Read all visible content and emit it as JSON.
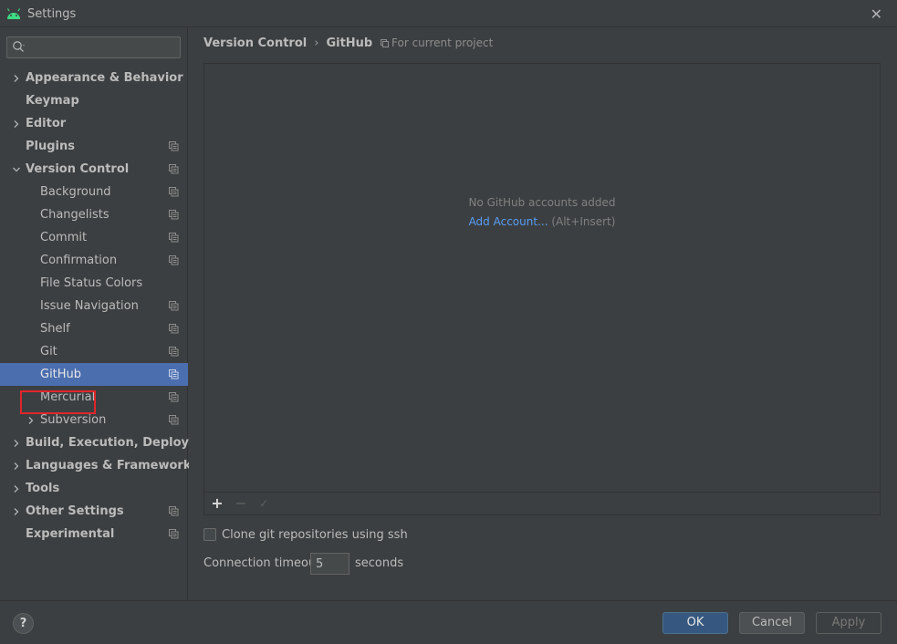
{
  "window": {
    "title": "Settings",
    "close_glyph": "✕"
  },
  "search": {
    "value": "",
    "placeholder": ""
  },
  "sidebar": {
    "items": [
      {
        "label": "Appearance & Behavior",
        "expander": "collapsed",
        "project": false
      },
      {
        "label": "Keymap",
        "expander": "none",
        "project": false
      },
      {
        "label": "Editor",
        "expander": "collapsed",
        "project": false
      },
      {
        "label": "Plugins",
        "expander": "none",
        "project": true
      },
      {
        "label": "Version Control",
        "expander": "expanded",
        "project": true
      },
      {
        "label": "Background",
        "expander": "none",
        "project": true
      },
      {
        "label": "Changelists",
        "expander": "none",
        "project": true
      },
      {
        "label": "Commit",
        "expander": "none",
        "project": true
      },
      {
        "label": "Confirmation",
        "expander": "none",
        "project": true
      },
      {
        "label": "File Status Colors",
        "expander": "none",
        "project": false
      },
      {
        "label": "Issue Navigation",
        "expander": "none",
        "project": true
      },
      {
        "label": "Shelf",
        "expander": "none",
        "project": true
      },
      {
        "label": "Git",
        "expander": "none",
        "project": true
      },
      {
        "label": "GitHub",
        "expander": "none",
        "project": true,
        "selected": true
      },
      {
        "label": "Mercurial",
        "expander": "none",
        "project": true
      },
      {
        "label": "Subversion",
        "expander": "collapsed",
        "project": true
      },
      {
        "label": "Build, Execution, Deployment",
        "expander": "collapsed",
        "project": false
      },
      {
        "label": "Languages & Frameworks",
        "expander": "collapsed",
        "project": false
      },
      {
        "label": "Tools",
        "expander": "collapsed",
        "project": false
      },
      {
        "label": "Other Settings",
        "expander": "collapsed",
        "project": true
      },
      {
        "label": "Experimental",
        "expander": "none",
        "project": true
      }
    ]
  },
  "breadcrumb": {
    "parent": "Version Control",
    "separator": "›",
    "current": "GitHub",
    "scope": "For current project"
  },
  "accounts": {
    "empty_text": "No GitHub accounts added",
    "add_link": "Add Account...",
    "add_shortcut": " (Alt+Insert)",
    "toolbar": {
      "add": "+",
      "remove": "−",
      "check": "✓"
    }
  },
  "options": {
    "clone_ssh_label": "Clone git repositories using ssh",
    "clone_ssh_checked": false,
    "timeout_label": "Connection timeout:",
    "timeout_value": "5",
    "timeout_unit": "seconds"
  },
  "footer": {
    "help": "?",
    "ok": "OK",
    "cancel": "Cancel",
    "apply": "Apply"
  },
  "colors": {
    "background": "#3c3f41",
    "selection": "#4b6eaf",
    "link": "#589df6",
    "android_green": "#3ddc84",
    "highlight_box": "#e0262b"
  }
}
